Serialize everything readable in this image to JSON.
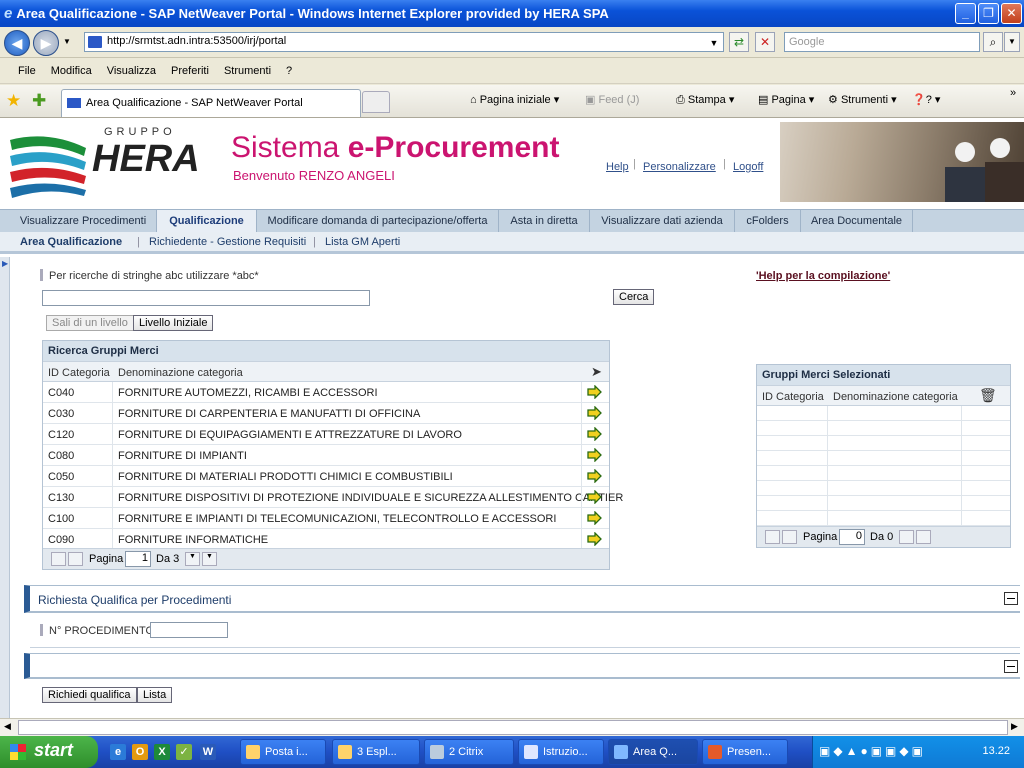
{
  "window": {
    "title": "Area Qualificazione - SAP NetWeaver Portal - Windows Internet Explorer provided by HERA SPA"
  },
  "browser": {
    "url": "http://srmtst.adn.intra:53500/irj/portal",
    "search_placeholder": "Google",
    "menu": [
      "File",
      "Modifica",
      "Visualizza",
      "Preferiti",
      "Strumenti",
      "?"
    ],
    "tab_title": "Area Qualificazione - SAP NetWeaver Portal",
    "toolbar": {
      "home": "Pagina iniziale",
      "feed": "Feed (J)",
      "print": "Stampa",
      "page": "Pagina",
      "tools": "Strumenti",
      "help": "?"
    }
  },
  "header": {
    "logo_top": "GRUPPO",
    "logo_main": "HERA",
    "title_part1": "Sistema ",
    "title_part2": "e-Procurement",
    "welcome": "Benvenuto RENZO ANGELI",
    "links": {
      "help": "Help",
      "personalize": "Personalizzare",
      "logoff": "Logoff"
    }
  },
  "top_nav": [
    "Visualizzare Procedimenti",
    "Qualificazione",
    "Modificare domanda di partecipazione/offerta",
    "Asta in diretta",
    "Visualizzare dati azienda",
    "cFolders",
    "Area Documentale"
  ],
  "sub_nav": [
    "Area Qualificazione",
    "Richiedente - Gestione Requisiti",
    "Lista GM Aperti"
  ],
  "search": {
    "hint": "Per ricerche di stringhe abc utilizzare *abc*",
    "value": "",
    "button": "Cerca",
    "help_link": "'Help per la compilazione'",
    "up_level": "Sali di un livello",
    "initial_level": "Livello Iniziale"
  },
  "gm_table": {
    "title": "Ricerca Gruppi Merci",
    "col_id": "ID Categoria",
    "col_name": "Denominazione categoria",
    "rows": [
      {
        "id": "C040",
        "name": "FORNITURE AUTOMEZZI, RICAMBI E ACCESSORI"
      },
      {
        "id": "C030",
        "name": "FORNITURE DI CARPENTERIA E MANUFATTI DI OFFICINA"
      },
      {
        "id": "C120",
        "name": "FORNITURE DI EQUIPAGGIAMENTI E ATTREZZATURE DI LAVORO"
      },
      {
        "id": "C080",
        "name": "FORNITURE DI IMPIANTI"
      },
      {
        "id": "C050",
        "name": "FORNITURE DI MATERIALI PRODOTTI CHIMICI E COMBUSTIBILI"
      },
      {
        "id": "C130",
        "name": "FORNITURE DISPOSITIVI DI PROTEZIONE INDIVIDUALE E SICUREZZA ALLESTIMENTO CANTIER"
      },
      {
        "id": "C100",
        "name": "FORNITURE E IMPIANTI DI TELECOMUNICAZIONI, TELECONTROLLO E ACCESSORI"
      },
      {
        "id": "C090",
        "name": "FORNITURE INFORMATICHE"
      }
    ],
    "pager": {
      "label": "Pagina",
      "page": "1",
      "of": "Da 3"
    }
  },
  "selected_table": {
    "title": "Gruppi Merci Selezionati",
    "col_id": "ID Categoria",
    "col_name": "Denominazione categoria",
    "pager": {
      "label": "Pagina",
      "page": "0",
      "of": "Da 0"
    }
  },
  "richiesta": {
    "title": "Richiesta Qualifica per Procedimenti",
    "label": "N° PROCEDIMENTO",
    "value": ""
  },
  "actions": {
    "request": "Richiedi qualifica",
    "list": "Lista"
  },
  "taskbar": {
    "start": "start",
    "tasks": [
      "Posta i...",
      "3 Espl...",
      "2 Citrix",
      "Istruzio...",
      "Area Q...",
      "Presen..."
    ],
    "clock": "13.22"
  }
}
